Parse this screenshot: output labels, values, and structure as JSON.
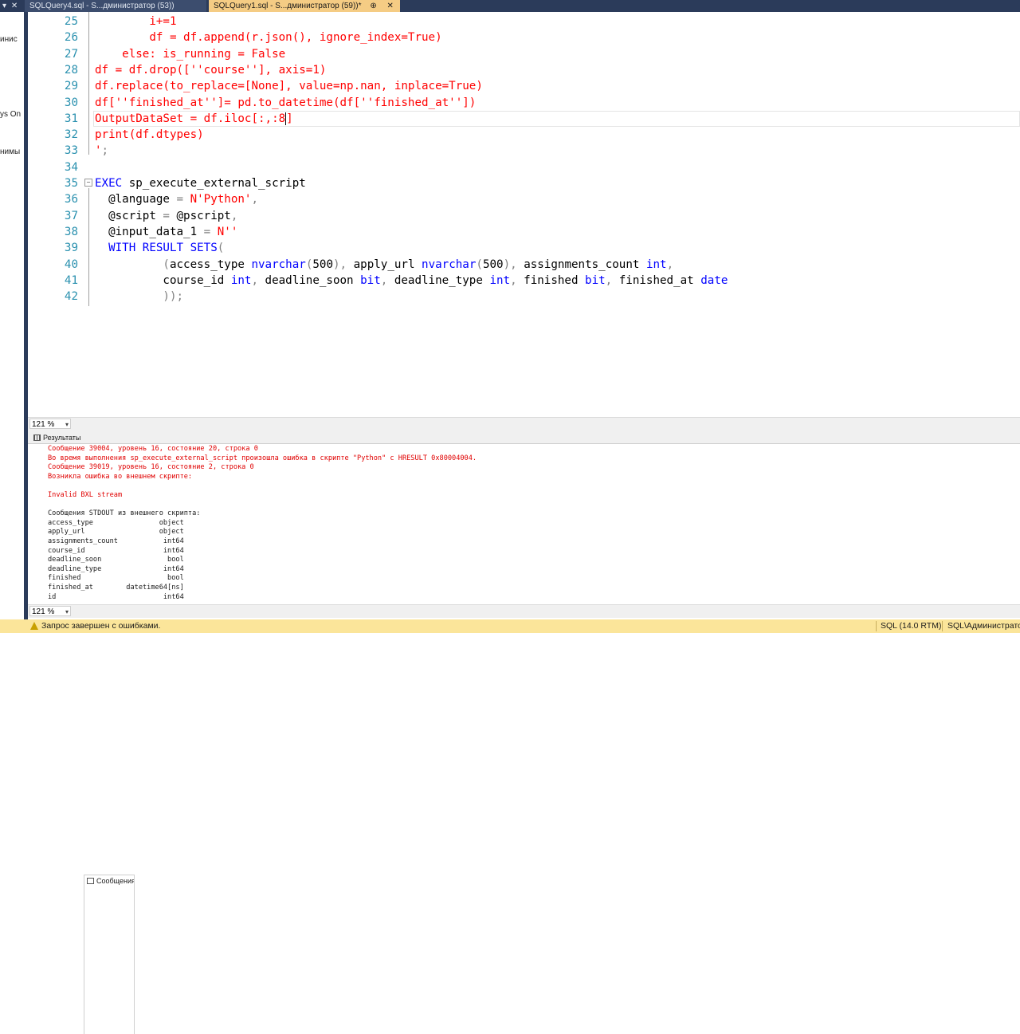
{
  "left_panel": {
    "pin_icon": "▾",
    "close_icon": "✕",
    "fragments": [
      "инис",
      "ys On",
      "нимы"
    ]
  },
  "tabs": [
    {
      "label": "SQLQuery4.sql - S...дминистратор (53))",
      "active": false
    },
    {
      "label": "SQLQuery1.sql - S...дминистратор (59))*",
      "active": true,
      "pin": "⊕",
      "close": "✕"
    }
  ],
  "editor": {
    "lines": [
      {
        "num": "25",
        "segments": [
          {
            "t": "        i+=1",
            "c": "red"
          }
        ]
      },
      {
        "num": "26",
        "segments": [
          {
            "t": "        df = df.append(r.json(), ignore_index=True)",
            "c": "red"
          }
        ]
      },
      {
        "num": "27",
        "segments": [
          {
            "t": "    else: is_running = False",
            "c": "red"
          }
        ]
      },
      {
        "num": "28",
        "segments": [
          {
            "t": "df = df.drop([''course''], axis=1)",
            "c": "red"
          }
        ]
      },
      {
        "num": "29",
        "segments": [
          {
            "t": "df.replace(to_replace=[None], value=np.nan, inplace=True)",
            "c": "red"
          }
        ]
      },
      {
        "num": "30",
        "segments": [
          {
            "t": "df[''finished_at'']= pd.to_datetime(df[''finished_at''])",
            "c": "red"
          }
        ]
      },
      {
        "num": "31",
        "segments": [
          {
            "t": "OutputDataSet = df.iloc[:,:8",
            "c": "red"
          },
          {
            "t": "]",
            "c": "red"
          }
        ],
        "caret": true
      },
      {
        "num": "32",
        "segments": [
          {
            "t": "print(df.dtypes)",
            "c": "red"
          }
        ]
      },
      {
        "num": "33",
        "segments": [
          {
            "t": "'",
            "c": "red"
          },
          {
            "t": ";",
            "c": "gray"
          }
        ]
      },
      {
        "num": "34",
        "segments": []
      },
      {
        "num": "35",
        "segments": [
          {
            "t": "EXEC",
            "c": "kw"
          },
          {
            "t": " sp_execute_external_script",
            "c": "black"
          }
        ],
        "fold": "−"
      },
      {
        "num": "36",
        "segments": [
          {
            "t": "  @language ",
            "c": "black"
          },
          {
            "t": "=",
            "c": "gray"
          },
          {
            "t": " N'Python'",
            "c": "red"
          },
          {
            "t": ",",
            "c": "gray"
          }
        ]
      },
      {
        "num": "37",
        "segments": [
          {
            "t": "  @script ",
            "c": "black"
          },
          {
            "t": "=",
            "c": "gray"
          },
          {
            "t": " @pscript",
            "c": "black"
          },
          {
            "t": ",",
            "c": "gray"
          }
        ]
      },
      {
        "num": "38",
        "segments": [
          {
            "t": "  @input_data_1 ",
            "c": "black"
          },
          {
            "t": "=",
            "c": "gray"
          },
          {
            "t": " N''",
            "c": "red"
          }
        ]
      },
      {
        "num": "39",
        "segments": [
          {
            "t": "  WITH RESULT SETS",
            "c": "kw"
          },
          {
            "t": "(",
            "c": "gray"
          }
        ]
      },
      {
        "num": "40",
        "segments": [
          {
            "t": "          ",
            "c": "black"
          },
          {
            "t": "(",
            "c": "gray"
          },
          {
            "t": "access_type ",
            "c": "black"
          },
          {
            "t": "nvarchar",
            "c": "kw"
          },
          {
            "t": "(",
            "c": "gray"
          },
          {
            "t": "500",
            "c": "black"
          },
          {
            "t": "),",
            "c": "gray"
          },
          {
            "t": " apply_url ",
            "c": "black"
          },
          {
            "t": "nvarchar",
            "c": "kw"
          },
          {
            "t": "(",
            "c": "gray"
          },
          {
            "t": "500",
            "c": "black"
          },
          {
            "t": "),",
            "c": "gray"
          },
          {
            "t": " assignments_count ",
            "c": "black"
          },
          {
            "t": "int",
            "c": "kw"
          },
          {
            "t": ",",
            "c": "gray"
          }
        ]
      },
      {
        "num": "41",
        "segments": [
          {
            "t": "          course_id ",
            "c": "black"
          },
          {
            "t": "int",
            "c": "kw"
          },
          {
            "t": ",",
            "c": "gray"
          },
          {
            "t": " deadline_soon ",
            "c": "black"
          },
          {
            "t": "bit",
            "c": "kw"
          },
          {
            "t": ",",
            "c": "gray"
          },
          {
            "t": " deadline_type ",
            "c": "black"
          },
          {
            "t": "int",
            "c": "kw"
          },
          {
            "t": ",",
            "c": "gray"
          },
          {
            "t": " finished ",
            "c": "black"
          },
          {
            "t": "bit",
            "c": "kw"
          },
          {
            "t": ",",
            "c": "gray"
          },
          {
            "t": " finished_at ",
            "c": "black"
          },
          {
            "t": "date",
            "c": "kw"
          }
        ]
      },
      {
        "num": "42",
        "segments": [
          {
            "t": "          ));",
            "c": "gray"
          }
        ]
      }
    ]
  },
  "zoom_top": {
    "value": "121 %",
    "dropdown_icon": "▾"
  },
  "results_tabs": {
    "results": "Результаты",
    "messages": "Сообщения"
  },
  "messages": [
    {
      "text": "Сообщение 39004, уровень 16, состояние 20, строка 0",
      "kind": "err"
    },
    {
      "text": "Во время выполнения sp_execute_external_script произошла ошибка в скрипте \"Python\" с HRESULT 0x80004004.",
      "kind": "err"
    },
    {
      "text": "Сообщение 39019, уровень 16, состояние 2, строка 0",
      "kind": "err"
    },
    {
      "text": "Возникла ошибка во внешнем скрипте:",
      "kind": "err"
    },
    {
      "text": "",
      "kind": "err"
    },
    {
      "text": "Invalid BXL stream",
      "kind": "err"
    },
    {
      "text": "",
      "kind": "out"
    },
    {
      "text": "Сообщения STDOUT из внешнего скрипта:",
      "kind": "out"
    },
    {
      "text": "access_type                object",
      "kind": "out"
    },
    {
      "text": "apply_url                  object",
      "kind": "out"
    },
    {
      "text": "assignments_count           int64",
      "kind": "out"
    },
    {
      "text": "course_id                   int64",
      "kind": "out"
    },
    {
      "text": "deadline_soon                bool",
      "kind": "out"
    },
    {
      "text": "deadline_type               int64",
      "kind": "out"
    },
    {
      "text": "finished                     bool",
      "kind": "out"
    },
    {
      "text": "finished_at        datetime64[ns]",
      "kind": "out"
    },
    {
      "text": "id                          int64",
      "kind": "out"
    }
  ],
  "zoom_bottom": {
    "value": "121 %",
    "dropdown_icon": "▾"
  },
  "status": {
    "message": "Запрос завершен с ошибками.",
    "version": "SQL (14.0 RTM)",
    "user": "SQL\\Администратор"
  }
}
